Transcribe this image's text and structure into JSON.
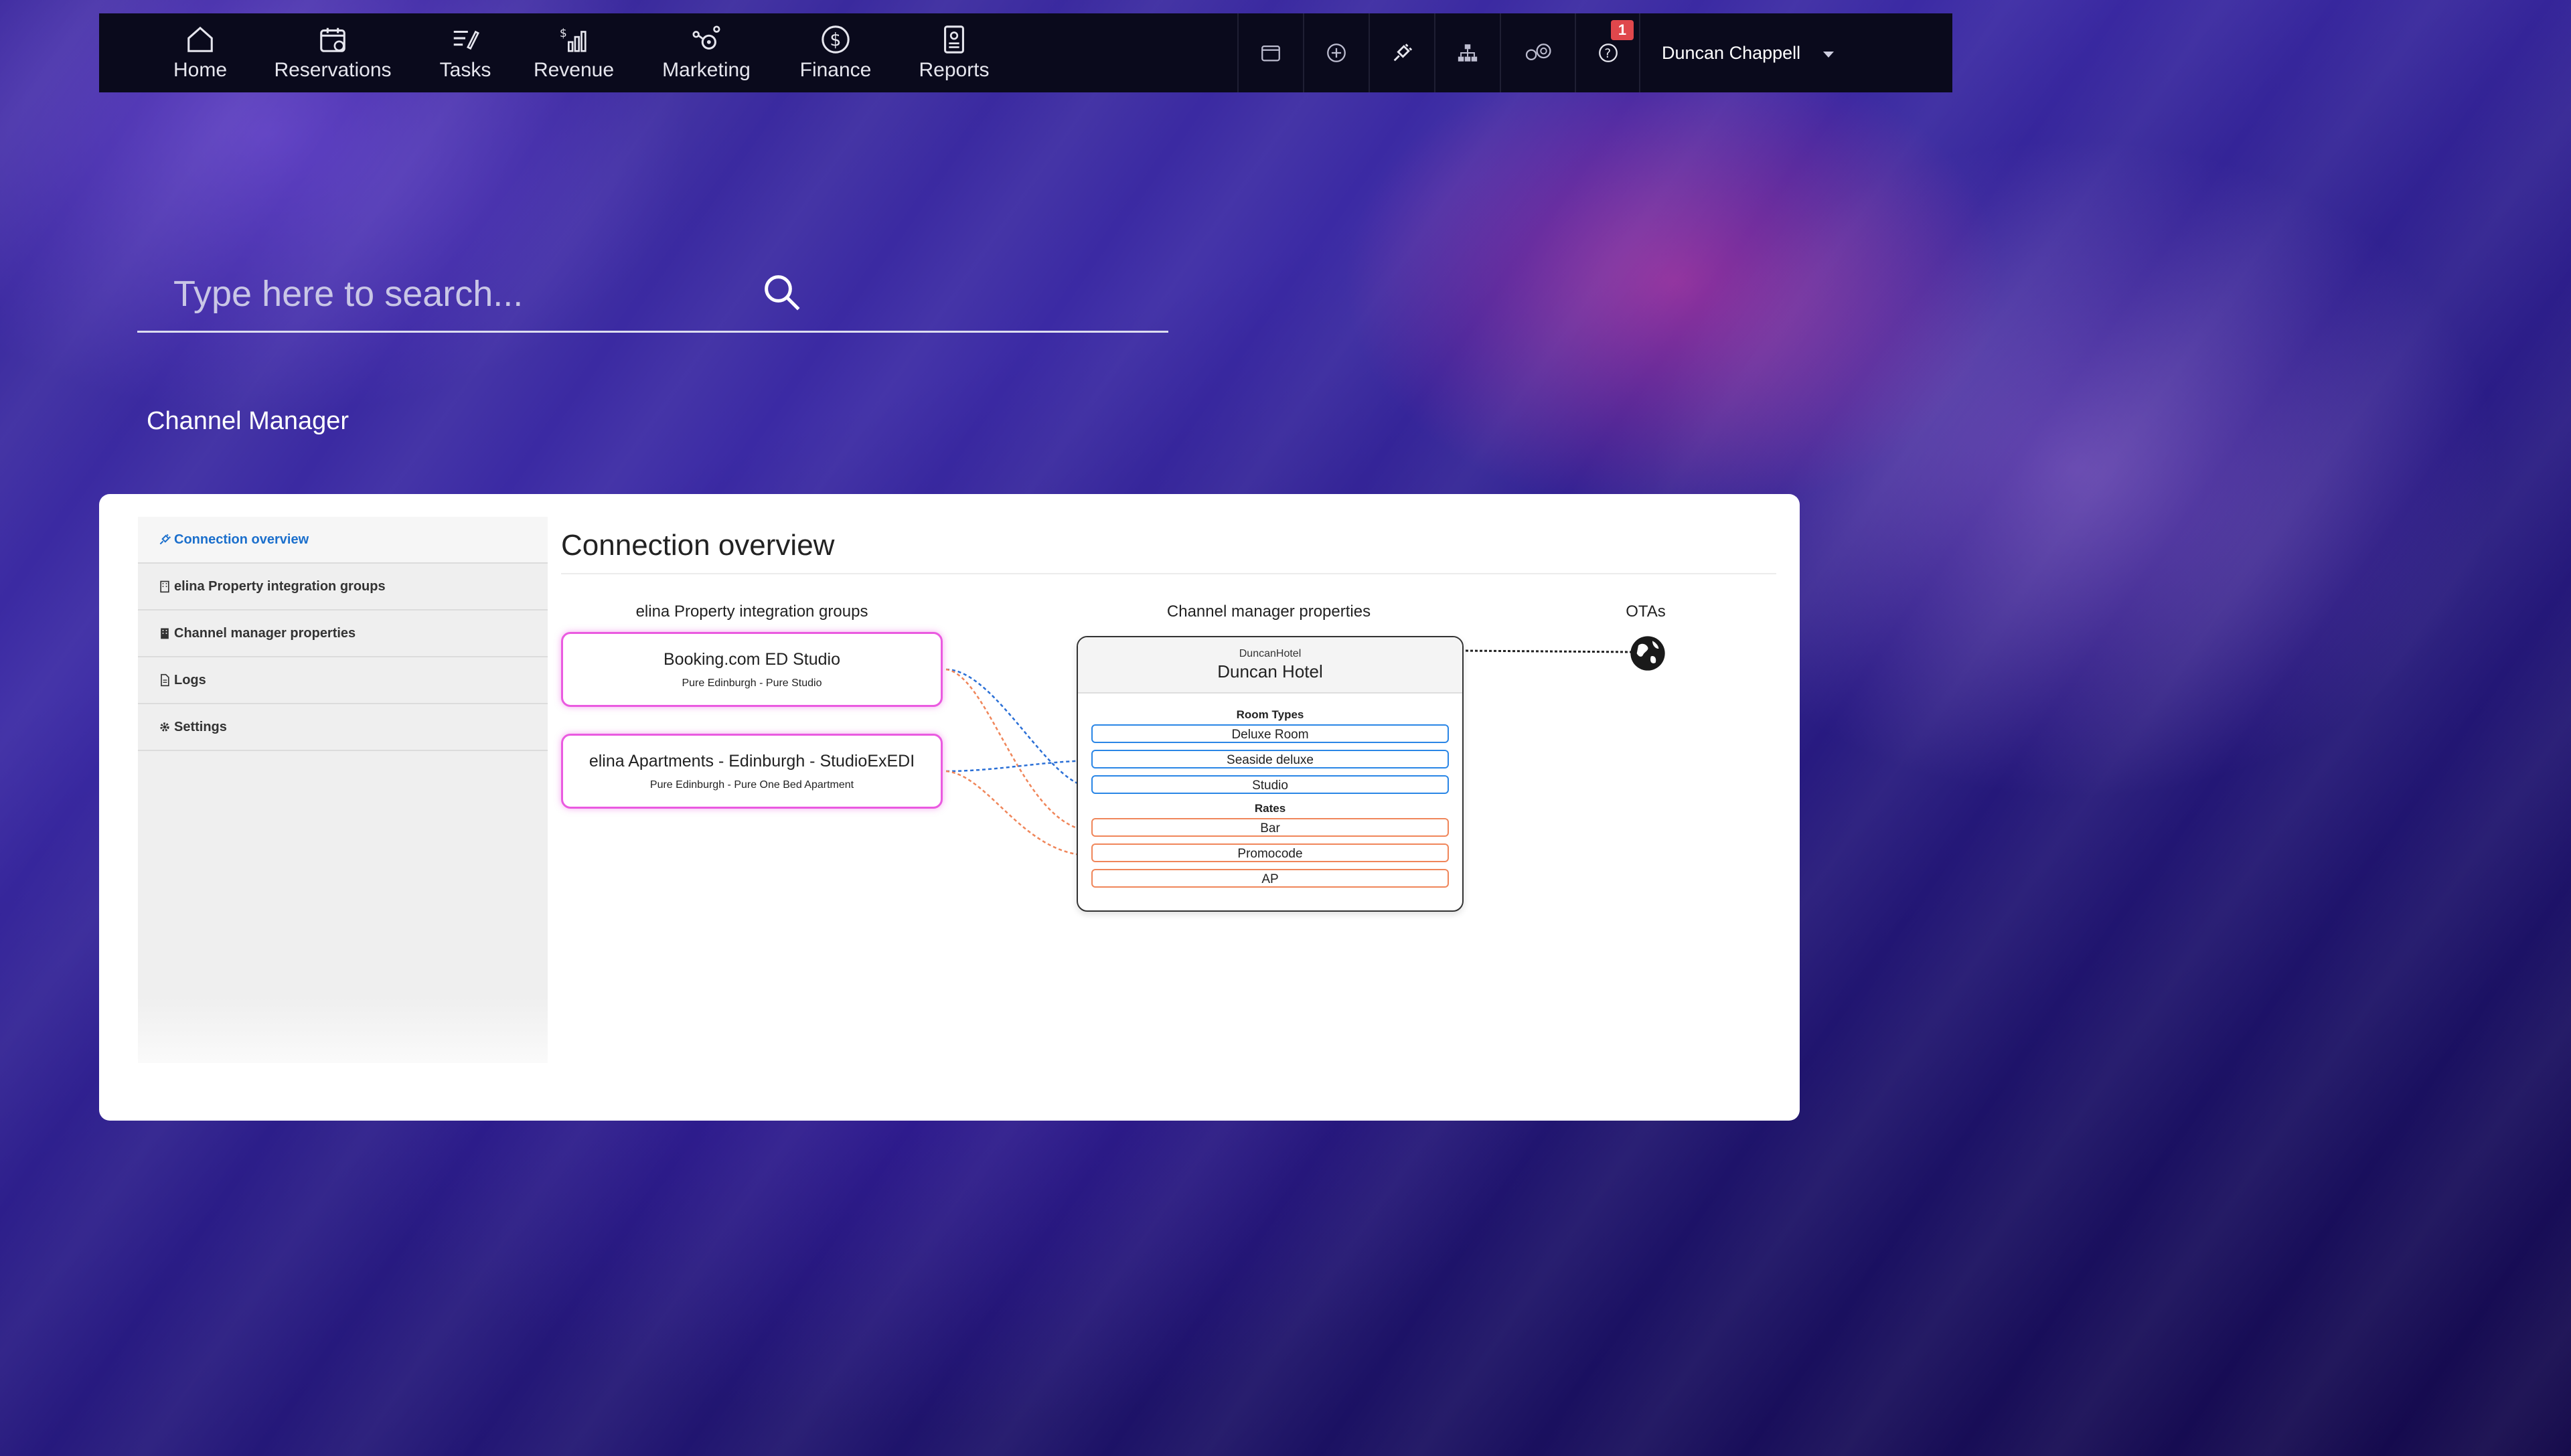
{
  "nav": {
    "items": [
      {
        "label": "Home",
        "icon": "home-icon"
      },
      {
        "label": "Reservations",
        "icon": "calendar-icon"
      },
      {
        "label": "Tasks",
        "icon": "tasks-icon"
      },
      {
        "label": "Revenue",
        "icon": "revenue-icon"
      },
      {
        "label": "Marketing",
        "icon": "marketing-icon"
      },
      {
        "label": "Finance",
        "icon": "dollar-icon"
      },
      {
        "label": "Reports",
        "icon": "report-icon"
      }
    ],
    "tools": [
      "calendar-icon",
      "plus-circle-icon",
      "plug-icon",
      "sitemap-icon",
      "gears-icon",
      "help-icon"
    ],
    "notification_count": "1",
    "user_name": "Duncan Chappell"
  },
  "search": {
    "placeholder": "Type here to search..."
  },
  "page_title": "Channel Manager",
  "sidebar": {
    "items": [
      {
        "label": "Connection overview",
        "icon": "plug-icon",
        "active": true
      },
      {
        "label": "elina Property integration groups",
        "icon": "building-icon",
        "active": false
      },
      {
        "label": "Channel manager properties",
        "icon": "building-icon",
        "active": false
      },
      {
        "label": "Logs",
        "icon": "file-icon",
        "active": false
      },
      {
        "label": "Settings",
        "icon": "gear-icon",
        "active": false
      }
    ]
  },
  "main": {
    "title": "Connection overview",
    "col_groups": "elina Property integration groups",
    "col_properties": "Channel manager properties",
    "col_otas": "OTAs",
    "groups": [
      {
        "name": "Booking.com ED Studio",
        "sub": "Pure Edinburgh - Pure Studio"
      },
      {
        "name": "elina Apartments - Edinburgh - StudioExEDI",
        "sub": "Pure Edinburgh - Pure One Bed Apartment"
      }
    ],
    "property": {
      "code": "DuncanHotel",
      "name": "Duncan Hotel",
      "room_types_label": "Room Types",
      "room_types": [
        "Deluxe Room",
        "Seaside deluxe",
        "Studio"
      ],
      "rates_label": "Rates",
      "rates": [
        "Bar",
        "Promocode",
        "AP"
      ]
    }
  },
  "colors": {
    "accent_blue": "#1b6fcc",
    "room_border": "#2a86e6",
    "rate_border": "#f0865a",
    "group_border": "#ea5ae0",
    "badge": "#e0474c"
  }
}
